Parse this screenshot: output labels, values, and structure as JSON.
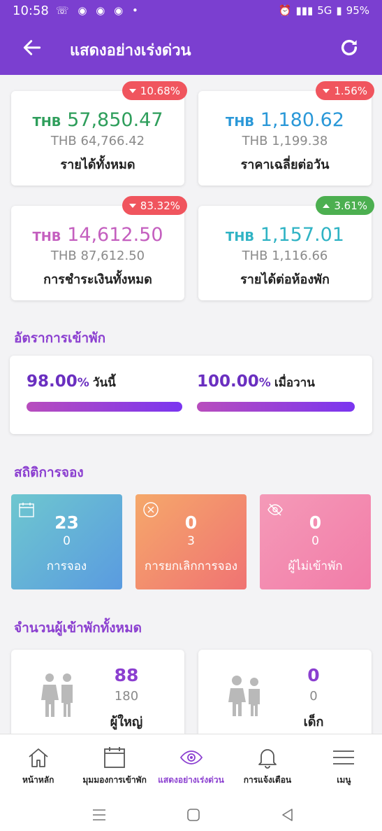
{
  "status_bar": {
    "time": "10:58",
    "battery": "95%",
    "network": "5G"
  },
  "app_bar": {
    "title": "แสดงอย่างเร่งด่วน"
  },
  "metrics": [
    {
      "currency": "THB",
      "value": "57,850.47",
      "previous": "THB 64,766.42",
      "label": "รายได้ทั้งหมด",
      "change": "10.68%",
      "trend": "down",
      "color": "#2e9e5b"
    },
    {
      "currency": "THB",
      "value": "1,180.62",
      "previous": "THB 1,199.38",
      "label": "ราคาเฉลี่ยต่อวัน",
      "change": "1.56%",
      "trend": "down",
      "color": "#2a98d8"
    },
    {
      "currency": "THB",
      "value": "14,612.50",
      "previous": "THB 87,612.50",
      "label": "การชำระเงินทั้งหมด",
      "change": "83.32%",
      "trend": "down",
      "color": "#c45fbf"
    },
    {
      "currency": "THB",
      "value": "1,157.01",
      "previous": "THB 1,116.66",
      "label": "รายได้ต่อห้องพัก",
      "change": "3.61%",
      "trend": "up",
      "color": "#2fb3c4"
    }
  ],
  "occupancy": {
    "title": "อัตราการเข้าพัก",
    "today": {
      "value": "98.00",
      "unit": "%",
      "label": "วันนี้",
      "fill": 0.98
    },
    "yesterday": {
      "value": "100.00",
      "unit": "%",
      "label": "เมื่อวาน",
      "fill": 1.0
    }
  },
  "booking_stats": {
    "title": "สถิติการจอง",
    "tiles": [
      {
        "icon": "calendar-icon",
        "count": "23",
        "sub": "0",
        "label": "การจอง"
      },
      {
        "icon": "cancel-circle-icon",
        "count": "0",
        "sub": "3",
        "label": "การยกเลิกการจอง"
      },
      {
        "icon": "eye-off-icon",
        "count": "0",
        "sub": "0",
        "label": "ผู้ไม่เข้าพัก"
      }
    ]
  },
  "guests": {
    "title": "จำนวนผู้เข้าพักทั้งหมด",
    "adults": {
      "count": "88",
      "sub": "180",
      "label": "ผู้ใหญ่"
    },
    "children": {
      "count": "0",
      "sub": "0",
      "label": "เด็ก"
    }
  },
  "bottom_nav": [
    {
      "icon": "home-icon",
      "label": "หน้าหลัก",
      "active": false
    },
    {
      "icon": "calendar-icon",
      "label": "มุมมองการเข้าพัก",
      "active": false
    },
    {
      "icon": "eye-icon",
      "label": "แสดงอย่างเร่งด่วน",
      "active": true
    },
    {
      "icon": "bell-icon",
      "label": "การแจ้งเตือน",
      "active": false
    },
    {
      "icon": "menu-icon",
      "label": "เมนู",
      "active": false
    }
  ],
  "colors": {
    "primary": "#7b3fd0",
    "badge_down": "#f0555e",
    "badge_up": "#4caf50"
  }
}
